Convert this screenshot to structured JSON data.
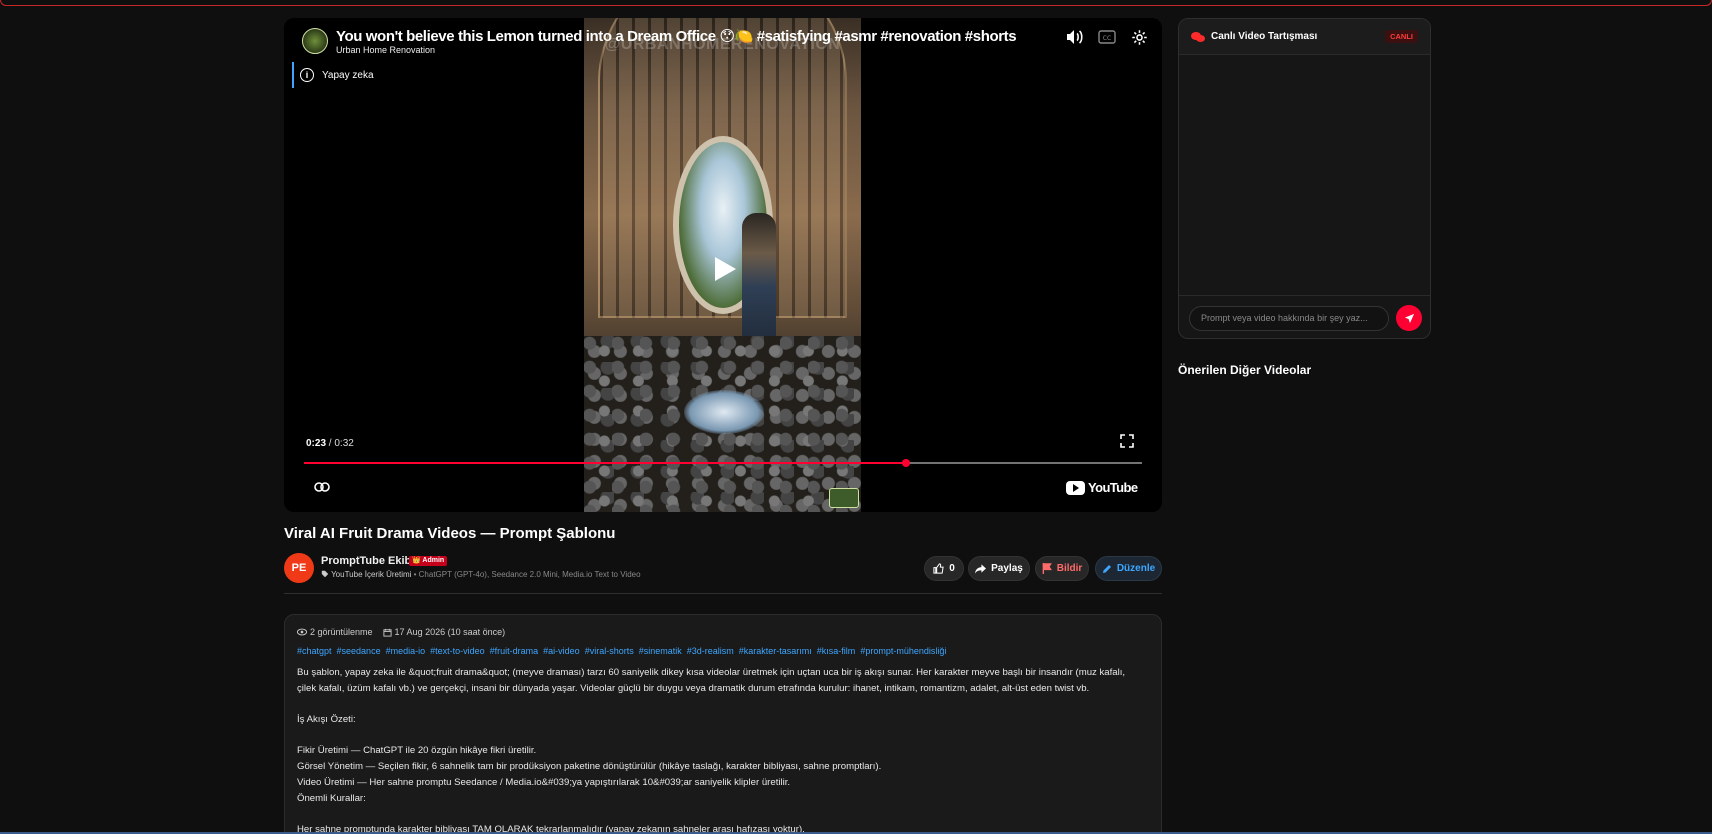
{
  "player": {
    "video_title": "You won't believe this Lemon turned into a Dream Office 😯🍋 #satisfying #asmr #renovation #shorts",
    "channel_name": "Urban Home Renovation",
    "watermark": "@URBANHOMERENOVATION",
    "ai_label": "Yapay zeka",
    "current_time": "0:23",
    "duration": "0:32",
    "progress_fraction": 0.7188,
    "youtube_logo": "YouTube",
    "icons": [
      "volume-icon",
      "captions-icon",
      "settings-icon",
      "info-icon",
      "play-icon",
      "fullscreen-icon",
      "link-icon",
      "youtube-logo-icon"
    ]
  },
  "page": {
    "title": "Viral AI Fruit Drama Videos — Prompt Şablonu"
  },
  "author": {
    "initials": "PE",
    "name": "PromptTube Ekibi",
    "badge": "👑 Admin",
    "category": "YouTube İçerik Üretimi",
    "tools": " • ChatGPT (GPT-4o), Seedance 2.0 Mini, Media.io Text to Video"
  },
  "actions": {
    "like_count": "0",
    "share_label": "Paylaş",
    "report_label": "Bildir",
    "edit_label": "Düzenle"
  },
  "description": {
    "views": "2 görüntülenme",
    "date": "17 Aug 2026 (10 saat önce)",
    "tags": [
      "#chatgpt",
      "#seedance",
      "#media-io",
      "#text-to-video",
      "#fruit-drama",
      "#ai-video",
      "#viral-shorts",
      "#sinematik",
      "#3d-realism",
      "#karakter-tasarımı",
      "#kısa-film",
      "#prompt-mühendisliği"
    ],
    "lines": [
      "Bu şablon, yapay zeka ile &quot;fruit drama&quot; (meyve draması) tarzı 60 saniyelik dikey kısa videolar üretmek için uçtan uca bir iş akışı sunar. Her karakter meyve başlı bir insandır (muz kafalı,",
      "çilek kafalı, üzüm kafalı vb.) ve gerçekçi, insani bir dünyada yaşar. Videolar güçlü bir duygu veya dramatik durum etrafında kurulur: ihanet, intikam, romantizm, adalet, alt-üst eden twist vb.",
      "",
      "İş Akışı Özeti:",
      "",
      "Fikir Üretimi — ChatGPT ile 20 özgün hikâye fikri üretilir.",
      "Görsel Yönetim — Seçilen fikir, 6 sahnelik tam bir prodüksiyon paketine dönüştürülür (hikâye taslağı, karakter bibliyası, sahne promptları).",
      "Video Üretimi — Her sahne promptu Seedance / Media.io&#039;ya yapıştırılarak 10&#039;ar saniyelik klipler üretilir.",
      "Önemli Kurallar:",
      "",
      "Her sahne promptunda karakter bibliyası TAM OLARAK tekrarlanmalıdır (yapay zekanın sahneler arası hafızası yoktur)."
    ]
  },
  "chat": {
    "title": "Canlı Video Tartışması",
    "live_badge": "CANLI",
    "input_placeholder": "Prompt veya video hakkında bir şey yaz..."
  },
  "sidebar": {
    "suggested_title": "Önerilen Diğer Videolar"
  },
  "colors": {
    "accent": "#ff0033",
    "link": "#3ea6ff",
    "background": "#0f0f0f",
    "avatar": "#f03a17"
  }
}
